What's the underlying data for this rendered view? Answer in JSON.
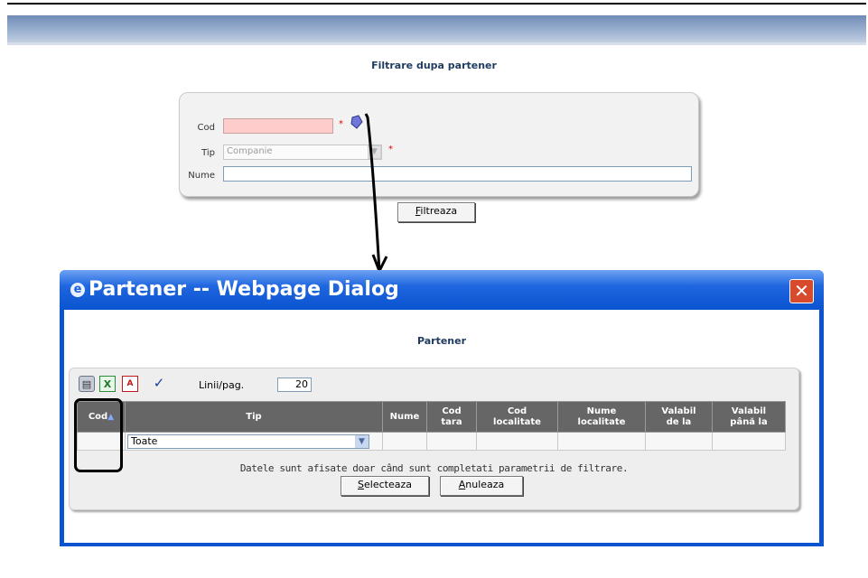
{
  "page": {
    "title": "Filtrare dupa partener"
  },
  "filter": {
    "cod_label": "Cod",
    "cod_value": "",
    "required_mark": "*",
    "tip_label": "Tip",
    "tip_value": "Companie",
    "nume_label": "Nume",
    "nume_value": "",
    "filter_button_accel": "F",
    "filter_button_rest": "iltreaza",
    "lookup_icon": "lookup-icon"
  },
  "dialog": {
    "window_title": "Partener -- Webpage Dialog",
    "heading": "Partener",
    "toolbar": {
      "print_icon": "printer-icon",
      "excel_icon": "excel-icon",
      "pdf_icon": "pdf-icon",
      "pdf_text": "A",
      "check_icon": "checkmark-icon",
      "check_glyph": "✓",
      "rows_label": "Linii/pag.",
      "rows_value": "20"
    },
    "grid": {
      "columns": [
        {
          "line1": "Cod",
          "line2": ""
        },
        {
          "line1": "Tip",
          "line2": ""
        },
        {
          "line1": "Nume",
          "line2": ""
        },
        {
          "line1": "Cod",
          "line2": "tara"
        },
        {
          "line1": "Cod",
          "line2": "localitate"
        },
        {
          "line1": "Nume",
          "line2": "localitate"
        },
        {
          "line1": "Valabil",
          "line2": "de la"
        },
        {
          "line1": "Valabil",
          "line2": "până la"
        }
      ],
      "tip_filter_value": "Toate",
      "info_message": "Datele sunt afisate doar când sunt completati parametrii de filtrare."
    },
    "select_button_accel": "S",
    "select_button_rest": "electeaza",
    "cancel_button_accel": "A",
    "cancel_button_rest": "nuleaza",
    "close_glyph": "✕",
    "ie_glyph": "e"
  },
  "colors": {
    "required_field_bg": "#ffcccc",
    "header_band": "#7f98c1",
    "dialog_blue": "#0a54d0",
    "grid_header": "#666666"
  }
}
